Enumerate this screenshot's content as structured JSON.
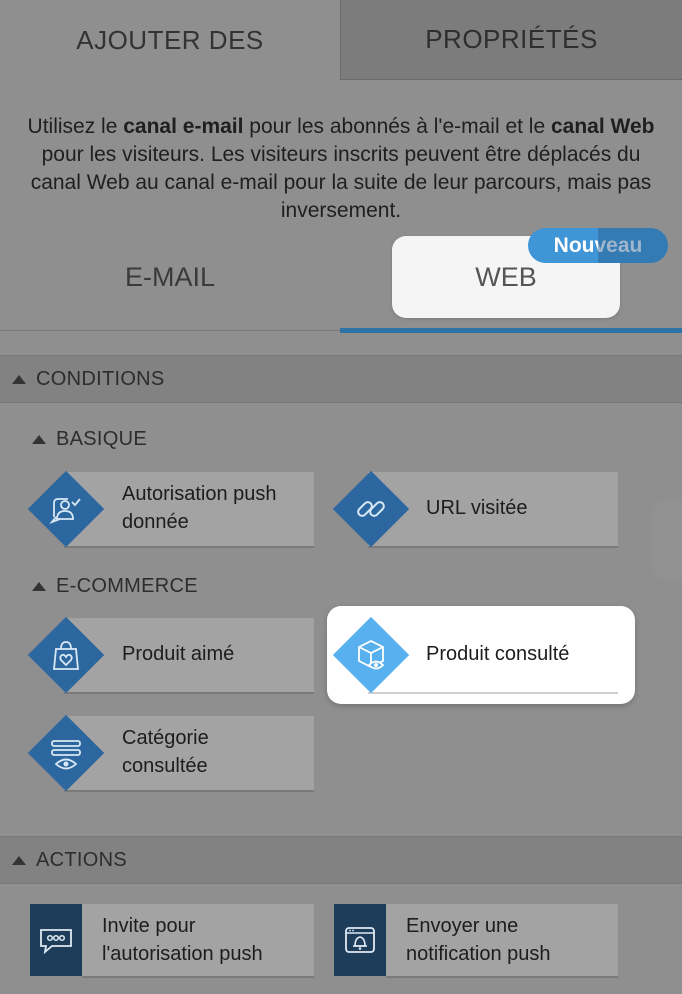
{
  "tabs": {
    "add": "AJOUTER DES",
    "properties": "PROPRIÉTÉS"
  },
  "intro": {
    "p1": "Utilisez le ",
    "b1": "canal e-mail",
    "p2": " pour les abonnés à l'e-mail et le ",
    "b2": "canal Web",
    "p3": " pour les visiteurs. Les visiteurs inscrits peuvent être déplacés du canal Web au canal e-mail pour la suite de leur parcours, mais pas inversement."
  },
  "channels": {
    "email": "E-MAIL",
    "web": "WEB",
    "badge": "Nouveau"
  },
  "sections": {
    "conditions": "CONDITIONS",
    "basic": "BASIQUE",
    "ecommerce": "E-COMMERCE",
    "actions": "ACTIONS"
  },
  "cards": {
    "push_granted": [
      "Autorisation push",
      "donnée"
    ],
    "url_visited": "URL visitée",
    "product_liked": "Produit aimé",
    "product_viewed": "Produit consulté",
    "category_viewed": [
      "Catégorie",
      "consultée"
    ],
    "push_invite": [
      "Invite pour",
      "l'autorisation push"
    ],
    "send_push": [
      "Envoyer une",
      "notification push"
    ]
  },
  "colors": {
    "accent": "#2f73a6",
    "badge": "#3f95d6",
    "icon_dark": "#1e3d5b",
    "diamond": "#2c67a0",
    "diamond_bright": "#59b0ee"
  },
  "icons": {
    "push_granted": "person-chat-check-icon",
    "url_visited": "link-icon",
    "product_liked": "shopping-bag-heart-icon",
    "product_viewed": "box-eye-icon",
    "category_viewed": "list-eye-icon",
    "push_invite": "chat-dots-icon",
    "send_push": "browser-bell-icon"
  }
}
